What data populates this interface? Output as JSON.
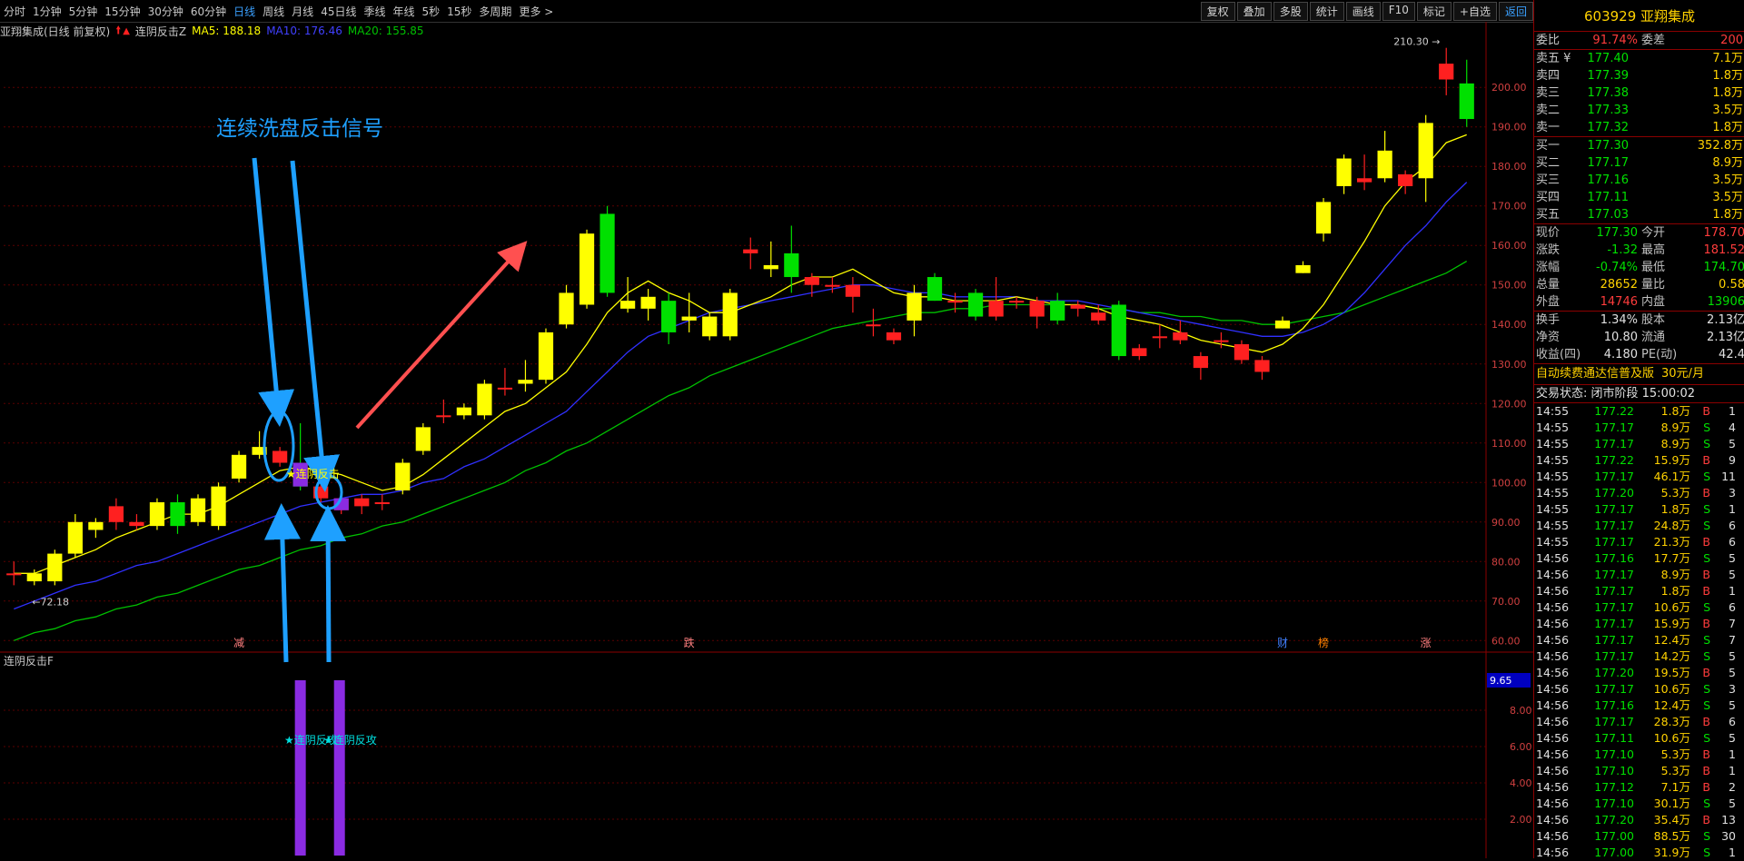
{
  "toolbar": {
    "periods": [
      "分时",
      "1分钟",
      "5分钟",
      "15分钟",
      "30分钟",
      "60分钟",
      "日线",
      "周线",
      "月线",
      "45日线",
      "季线",
      "年线",
      "5秒",
      "15秒",
      "多周期",
      "更多 >"
    ],
    "active_period": "日线",
    "right_buttons": [
      "复权",
      "叠加",
      "多股",
      "统计",
      "画线",
      "F10",
      "标记",
      "+自选",
      "返回"
    ]
  },
  "chart_header": {
    "stock": "亚翔集成(日线 前复权)",
    "indicator": "连阴反击Z",
    "ma5_label": "MA5: 188.18",
    "ma10_label": "MA10: 176.46",
    "ma20_label": "MA20: 155.85",
    "colors": {
      "ma5": "#ffff00",
      "ma10": "#3030ff",
      "ma20": "#00c000"
    }
  },
  "main_chart": {
    "y_ticks": [
      "200.00",
      "190.00",
      "180.00",
      "170.00",
      "160.00",
      "150.00",
      "140.00",
      "130.00",
      "120.00",
      "110.00",
      "100.00",
      "90.00",
      "80.00",
      "70.00",
      "60.00"
    ],
    "high_label": "210.30",
    "low_label": "72.18",
    "annotation_title": "连续洗盘反击信号",
    "signal_label": "★连阴反击",
    "bottom_markers": [
      "减",
      "跌",
      "财",
      "榜",
      "涨"
    ]
  },
  "chart_data": [
    {
      "type": "candlestick",
      "title": "",
      "y_range": [
        58,
        212
      ],
      "candles": [
        {
          "o": 77,
          "c": 77,
          "h": 80,
          "l": 74
        },
        {
          "o": 75,
          "c": 77,
          "h": 78,
          "l": 74
        },
        {
          "o": 75,
          "c": 82,
          "h": 83,
          "l": 74
        },
        {
          "o": 82,
          "c": 90,
          "h": 92,
          "l": 81
        },
        {
          "o": 88,
          "c": 90,
          "h": 91,
          "l": 86
        },
        {
          "o": 94,
          "c": 90,
          "h": 96,
          "l": 88
        },
        {
          "o": 90,
          "c": 89,
          "h": 92,
          "l": 88
        },
        {
          "o": 89,
          "c": 95,
          "h": 96,
          "l": 88
        },
        {
          "o": 95,
          "c": 89,
          "h": 97,
          "l": 87
        },
        {
          "o": 90,
          "c": 96,
          "h": 97,
          "l": 89
        },
        {
          "o": 89,
          "c": 99,
          "h": 100,
          "l": 88
        },
        {
          "o": 101,
          "c": 107,
          "h": 108,
          "l": 100
        },
        {
          "o": 107,
          "c": 109,
          "h": 113,
          "l": 106
        },
        {
          "o": 108,
          "c": 105,
          "h": 109,
          "l": 104
        },
        {
          "o": 105,
          "c": 99,
          "h": 115,
          "l": 98
        },
        {
          "o": 99,
          "c": 96,
          "h": 101,
          "l": 95
        },
        {
          "o": 96,
          "c": 93,
          "h": 99,
          "l": 92
        },
        {
          "o": 96,
          "c": 94,
          "h": 97,
          "l": 92
        },
        {
          "o": 95,
          "c": 95,
          "h": 97,
          "l": 93
        },
        {
          "o": 98,
          "c": 105,
          "h": 106,
          "l": 97
        },
        {
          "o": 108,
          "c": 114,
          "h": 115,
          "l": 107
        },
        {
          "o": 117,
          "c": 117,
          "h": 121,
          "l": 115
        },
        {
          "o": 117,
          "c": 119,
          "h": 120,
          "l": 116
        },
        {
          "o": 117,
          "c": 125,
          "h": 126,
          "l": 116
        },
        {
          "o": 124,
          "c": 124,
          "h": 129,
          "l": 122
        },
        {
          "o": 125,
          "c": 126,
          "h": 131,
          "l": 123
        },
        {
          "o": 126,
          "c": 138,
          "h": 139,
          "l": 125
        },
        {
          "o": 140,
          "c": 148,
          "h": 150,
          "l": 139
        },
        {
          "o": 145,
          "c": 163,
          "h": 164,
          "l": 144
        },
        {
          "o": 168,
          "c": 148,
          "h": 170,
          "l": 147
        },
        {
          "o": 144,
          "c": 146,
          "h": 152,
          "l": 143
        },
        {
          "o": 144,
          "c": 147,
          "h": 149,
          "l": 141
        },
        {
          "o": 146,
          "c": 138,
          "h": 148,
          "l": 135
        },
        {
          "o": 141,
          "c": 142,
          "h": 148,
          "l": 138
        },
        {
          "o": 137,
          "c": 142,
          "h": 143,
          "l": 136
        },
        {
          "o": 137,
          "c": 148,
          "h": 149,
          "l": 136
        },
        {
          "o": 159,
          "c": 158,
          "h": 162,
          "l": 154
        },
        {
          "o": 154,
          "c": 155,
          "h": 161,
          "l": 152
        },
        {
          "o": 158,
          "c": 152,
          "h": 165,
          "l": 148
        },
        {
          "o": 152,
          "c": 150,
          "h": 153,
          "l": 147
        },
        {
          "o": 150,
          "c": 150,
          "h": 152,
          "l": 148
        },
        {
          "o": 150,
          "c": 147,
          "h": 152,
          "l": 143
        },
        {
          "o": 140,
          "c": 140,
          "h": 144,
          "l": 137
        },
        {
          "o": 138,
          "c": 136,
          "h": 139,
          "l": 135
        },
        {
          "o": 141,
          "c": 148,
          "h": 150,
          "l": 137
        },
        {
          "o": 152,
          "c": 146,
          "h": 153,
          "l": 146
        },
        {
          "o": 146,
          "c": 146,
          "h": 148,
          "l": 143
        },
        {
          "o": 148,
          "c": 142,
          "h": 149,
          "l": 141
        },
        {
          "o": 146,
          "c": 142,
          "h": 152,
          "l": 141
        },
        {
          "o": 146,
          "c": 146,
          "h": 147,
          "l": 144
        },
        {
          "o": 146,
          "c": 142,
          "h": 147,
          "l": 139
        },
        {
          "o": 146,
          "c": 141,
          "h": 148,
          "l": 140
        },
        {
          "o": 145,
          "c": 144,
          "h": 146,
          "l": 142
        },
        {
          "o": 143,
          "c": 141,
          "h": 145,
          "l": 140
        },
        {
          "o": 145,
          "c": 132,
          "h": 146,
          "l": 131
        },
        {
          "o": 134,
          "c": 132,
          "h": 135,
          "l": 131
        },
        {
          "o": 137,
          "c": 137,
          "h": 140,
          "l": 134
        },
        {
          "o": 138,
          "c": 136,
          "h": 141,
          "l": 135
        },
        {
          "o": 132,
          "c": 129,
          "h": 133,
          "l": 126
        },
        {
          "o": 136,
          "c": 136,
          "h": 138,
          "l": 134
        },
        {
          "o": 135,
          "c": 131,
          "h": 136,
          "l": 130
        },
        {
          "o": 131,
          "c": 128,
          "h": 132,
          "l": 126
        },
        {
          "o": 139,
          "c": 141,
          "h": 142,
          "l": 139
        },
        {
          "o": 153,
          "c": 155,
          "h": 156,
          "l": 153
        },
        {
          "o": 163,
          "c": 171,
          "h": 172,
          "l": 161
        },
        {
          "o": 175,
          "c": 182,
          "h": 183,
          "l": 173
        },
        {
          "o": 177,
          "c": 176,
          "h": 183,
          "l": 174
        },
        {
          "o": 177,
          "c": 184,
          "h": 189,
          "l": 176
        },
        {
          "o": 178,
          "c": 175,
          "h": 179,
          "l": 173
        },
        {
          "o": 177,
          "c": 191,
          "h": 193,
          "l": 171
        },
        {
          "o": 206,
          "c": 202,
          "h": 210,
          "l": 198
        },
        {
          "o": 201,
          "c": 192,
          "h": 207,
          "l": 190
        }
      ],
      "ma5": [
        77,
        77,
        79,
        81,
        83,
        86,
        88,
        90,
        92,
        92,
        94,
        97,
        100,
        103,
        104,
        103,
        102,
        100,
        98,
        99,
        102,
        106,
        110,
        114,
        118,
        120,
        124,
        128,
        135,
        143,
        148,
        151,
        148,
        146,
        143,
        143,
        145,
        147,
        150,
        152,
        152,
        154,
        151,
        148,
        147,
        147,
        146,
        146,
        146,
        147,
        146,
        145,
        145,
        144,
        142,
        141,
        140,
        138,
        136,
        135,
        134,
        133,
        135,
        139,
        145,
        153,
        161,
        170,
        176,
        180,
        186,
        188
      ],
      "ma10": [
        68,
        70,
        72,
        74,
        75,
        77,
        79,
        80,
        82,
        84,
        86,
        88,
        90,
        92,
        94,
        95,
        96,
        97,
        97,
        98,
        100,
        101,
        104,
        106,
        109,
        112,
        115,
        118,
        123,
        128,
        133,
        137,
        139,
        141,
        143,
        144,
        145,
        146,
        147,
        148,
        149,
        150,
        150,
        149,
        148,
        148,
        147,
        147,
        147,
        147,
        146,
        146,
        146,
        145,
        144,
        143,
        142,
        141,
        140,
        139,
        138,
        137,
        137,
        138,
        140,
        143,
        148,
        154,
        160,
        165,
        171,
        176
      ],
      "ma20": [
        60,
        62,
        63,
        65,
        66,
        68,
        69,
        71,
        72,
        74,
        76,
        78,
        79,
        81,
        83,
        84,
        86,
        87,
        89,
        90,
        92,
        94,
        96,
        98,
        100,
        103,
        105,
        108,
        110,
        113,
        116,
        119,
        122,
        124,
        127,
        129,
        131,
        133,
        135,
        137,
        139,
        140,
        141,
        142,
        143,
        143,
        144,
        144,
        145,
        145,
        145,
        145,
        145,
        144,
        144,
        143,
        143,
        142,
        142,
        141,
        141,
        140,
        140,
        141,
        142,
        143,
        145,
        147,
        149,
        151,
        153,
        156
      ]
    },
    {
      "type": "bar",
      "title": "连阴反击F",
      "y_ticks": [
        "8.00",
        "6.00",
        "4.00",
        "2.00"
      ],
      "y_range": [
        0,
        10.5
      ],
      "current_value_label": "9.65",
      "bars": [
        {
          "index": 14,
          "value": 9.65
        },
        {
          "index": 16,
          "value": 9.65
        }
      ],
      "bar_label": "★连阴反攻"
    }
  ],
  "right_panel": {
    "title": "603929 亚翔集成",
    "weibi_label": "委比",
    "weibi_value": "91.74%",
    "weicha_label": "委差",
    "weicha_value": "200",
    "sells": [
      {
        "label": "卖五 ¥",
        "price": "177.40",
        "vol": "7.1万"
      },
      {
        "label": "卖四",
        "price": "177.39",
        "vol": "1.8万"
      },
      {
        "label": "卖三",
        "price": "177.38",
        "vol": "1.8万"
      },
      {
        "label": "卖二",
        "price": "177.33",
        "vol": "3.5万"
      },
      {
        "label": "卖一",
        "price": "177.32",
        "vol": "1.8万"
      }
    ],
    "buys": [
      {
        "label": "买一",
        "price": "177.30",
        "vol": "352.8万"
      },
      {
        "label": "买二",
        "price": "177.17",
        "vol": "8.9万"
      },
      {
        "label": "买三",
        "price": "177.16",
        "vol": "3.5万"
      },
      {
        "label": "买四",
        "price": "177.11",
        "vol": "3.5万"
      },
      {
        "label": "买五",
        "price": "177.03",
        "vol": "1.8万"
      }
    ],
    "quote": [
      {
        "l1": "现价",
        "v1": "177.30",
        "c1": "down",
        "l2": "今开",
        "v2": "178.70",
        "c2": "up"
      },
      {
        "l1": "涨跌",
        "v1": "-1.32",
        "c1": "down",
        "l2": "最高",
        "v2": "181.52",
        "c2": "up"
      },
      {
        "l1": "涨幅",
        "v1": "-0.74%",
        "c1": "down",
        "l2": "最低",
        "v2": "174.70",
        "c2": "down"
      },
      {
        "l1": "总量",
        "v1": "28652",
        "c1": "yel",
        "l2": "量比",
        "v2": "0.58",
        "c2": "yel"
      },
      {
        "l1": "外盘",
        "v1": "14746",
        "c1": "up",
        "l2": "内盘",
        "v2": "13906",
        "c2": "down"
      }
    ],
    "quote2": [
      {
        "l1": "换手",
        "v1": "1.34%",
        "l2": "股本",
        "v2": "2.13亿"
      },
      {
        "l1": "净资",
        "v1": "10.80",
        "l2": "流通",
        "v2": "2.13亿"
      },
      {
        "l1": "收益(四)",
        "v1": "4.180",
        "l2": "PE(动)",
        "v2": "42.4"
      }
    ],
    "promo": "自动续费通达信普及版",
    "promo_price": "30元/月",
    "status": "交易状态: 闭市阶段 15:00:02",
    "ticks": [
      {
        "t": "14:55",
        "p": "177.22",
        "v": "1.8万",
        "s": "B",
        "n": "1"
      },
      {
        "t": "14:55",
        "p": "177.17",
        "v": "8.9万",
        "s": "S",
        "n": "4"
      },
      {
        "t": "14:55",
        "p": "177.17",
        "v": "8.9万",
        "s": "S",
        "n": "5"
      },
      {
        "t": "14:55",
        "p": "177.22",
        "v": "15.9万",
        "s": "B",
        "n": "9"
      },
      {
        "t": "14:55",
        "p": "177.17",
        "v": "46.1万",
        "s": "S",
        "n": "11"
      },
      {
        "t": "14:55",
        "p": "177.20",
        "v": "5.3万",
        "s": "B",
        "n": "3"
      },
      {
        "t": "14:55",
        "p": "177.17",
        "v": "1.8万",
        "s": "S",
        "n": "1"
      },
      {
        "t": "14:55",
        "p": "177.17",
        "v": "24.8万",
        "s": "S",
        "n": "6"
      },
      {
        "t": "14:55",
        "p": "177.17",
        "v": "21.3万",
        "s": "B",
        "n": "6"
      },
      {
        "t": "14:56",
        "p": "177.16",
        "v": "17.7万",
        "s": "S",
        "n": "5"
      },
      {
        "t": "14:56",
        "p": "177.17",
        "v": "8.9万",
        "s": "B",
        "n": "5"
      },
      {
        "t": "14:56",
        "p": "177.17",
        "v": "1.8万",
        "s": "B",
        "n": "1"
      },
      {
        "t": "14:56",
        "p": "177.17",
        "v": "10.6万",
        "s": "S",
        "n": "6"
      },
      {
        "t": "14:56",
        "p": "177.17",
        "v": "15.9万",
        "s": "B",
        "n": "7"
      },
      {
        "t": "14:56",
        "p": "177.17",
        "v": "12.4万",
        "s": "S",
        "n": "7"
      },
      {
        "t": "14:56",
        "p": "177.17",
        "v": "14.2万",
        "s": "S",
        "n": "5"
      },
      {
        "t": "14:56",
        "p": "177.20",
        "v": "19.5万",
        "s": "B",
        "n": "5"
      },
      {
        "t": "14:56",
        "p": "177.17",
        "v": "10.6万",
        "s": "S",
        "n": "3"
      },
      {
        "t": "14:56",
        "p": "177.16",
        "v": "12.4万",
        "s": "S",
        "n": "5"
      },
      {
        "t": "14:56",
        "p": "177.17",
        "v": "28.3万",
        "s": "B",
        "n": "6"
      },
      {
        "t": "14:56",
        "p": "177.11",
        "v": "10.6万",
        "s": "S",
        "n": "5"
      },
      {
        "t": "14:56",
        "p": "177.10",
        "v": "5.3万",
        "s": "B",
        "n": "1"
      },
      {
        "t": "14:56",
        "p": "177.10",
        "v": "5.3万",
        "s": "B",
        "n": "1"
      },
      {
        "t": "14:56",
        "p": "177.12",
        "v": "7.1万",
        "s": "B",
        "n": "2"
      },
      {
        "t": "14:56",
        "p": "177.10",
        "v": "30.1万",
        "s": "S",
        "n": "5"
      },
      {
        "t": "14:56",
        "p": "177.20",
        "v": "35.4万",
        "s": "B",
        "n": "13"
      },
      {
        "t": "14:56",
        "p": "177.00",
        "v": "88.5万",
        "s": "S",
        "n": "30"
      },
      {
        "t": "14:56",
        "p": "177.00",
        "v": "31.9万",
        "s": "S",
        "n": "1"
      }
    ]
  }
}
